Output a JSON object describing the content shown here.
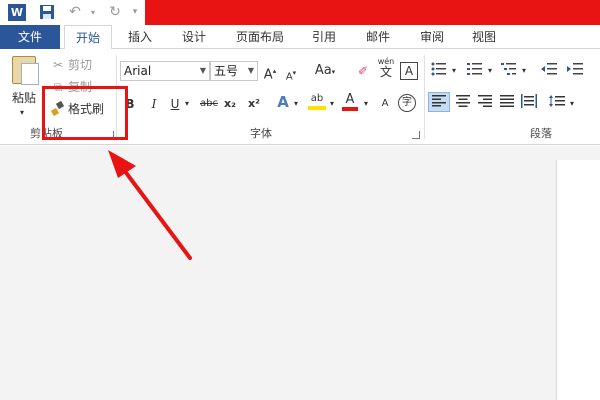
{
  "quick_access": {
    "word_logo_text": "W",
    "save_icon": "save-icon",
    "undo_icon": "undo-icon",
    "redo_icon": "redo-icon"
  },
  "tabs": {
    "file": "文件",
    "items": [
      "开始",
      "插入",
      "设计",
      "页面布局",
      "引用",
      "邮件",
      "审阅",
      "视图"
    ],
    "active_index": 0
  },
  "clipboard": {
    "paste_label": "粘贴",
    "cut_label": "剪切",
    "copy_label": "复制",
    "format_painter_label": "格式刷",
    "group_label": "剪贴板"
  },
  "font": {
    "font_name": "Arial",
    "font_size": "五号",
    "grow_label": "A",
    "shrink_label": "A",
    "case_label": "Aa",
    "phonetic_label": "wén",
    "phonetic_char": "文",
    "border_char_label": "A",
    "bold_label": "B",
    "italic_label": "I",
    "underline_label": "U",
    "strike_label": "abc",
    "subscript_label": "x₂",
    "superscript_label": "x²",
    "effects_label": "A",
    "highlight_label": "ab",
    "font_color_label": "A",
    "enclose_label": "字",
    "group_label": "字体"
  },
  "paragraph": {
    "group_label": "段落"
  },
  "colors": {
    "accent": "#2b579a",
    "alert_red": "#e81313"
  }
}
